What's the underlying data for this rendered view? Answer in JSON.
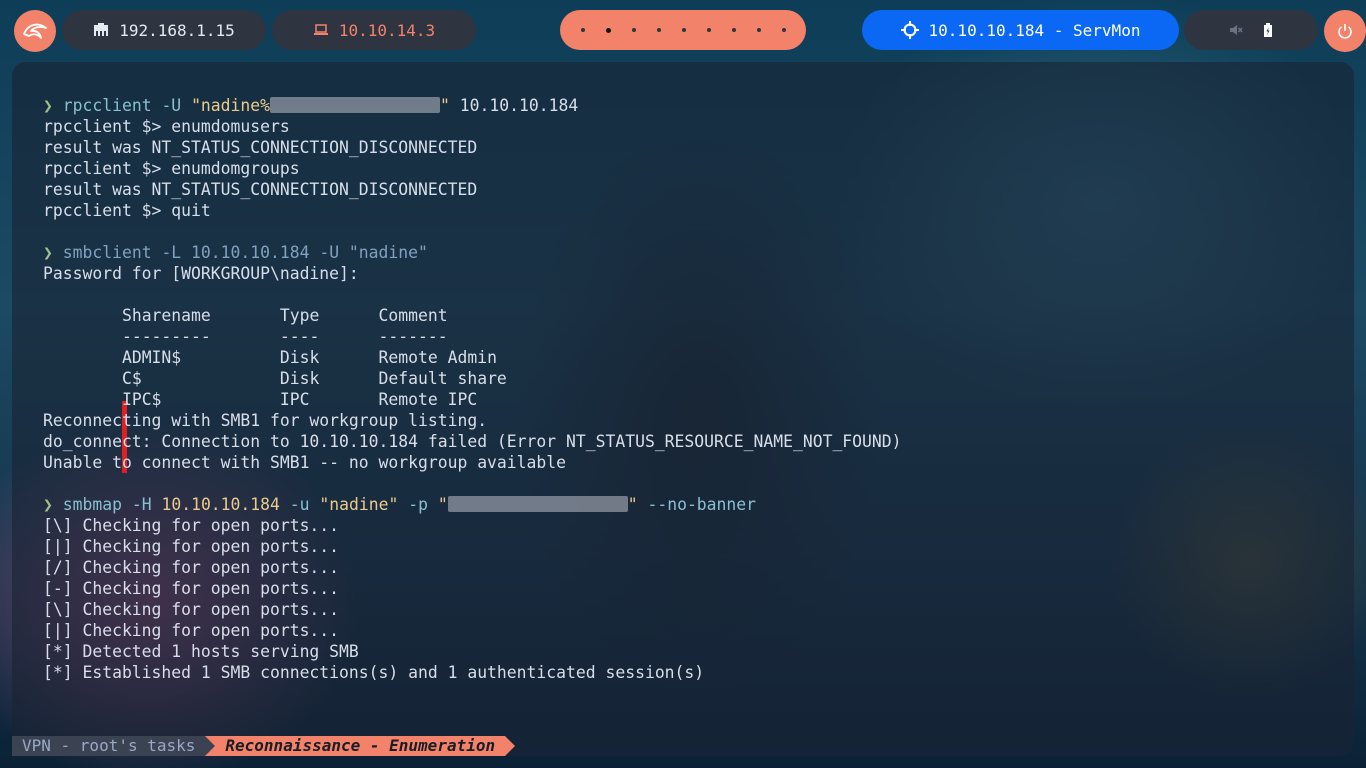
{
  "topbar": {
    "local_ip": "192.168.1.15",
    "vpn_ip": "10.10.14.3",
    "workspaces_count": 9,
    "active_workspace_index": 1,
    "target_label": "10.10.10.184 - ServMon",
    "icons": {
      "logo": "kali-dragon-icon",
      "local": "ethernet-icon",
      "vpn": "laptop-icon",
      "target": "crosshair-icon",
      "mute": "volume-muted-icon",
      "battery": "battery-icon",
      "power": "power-icon"
    },
    "colors": {
      "accent": "#f2836a",
      "target": "#0a68f5",
      "pill": "#2e3440"
    }
  },
  "terminal": {
    "block1": {
      "prompt": "❯",
      "cmd": "rpcclient",
      "flag": "-U",
      "arg_prefix": "\"nadine%",
      "arg_suffix": "\"",
      "host": "10.10.10.184",
      "out": [
        "rpcclient $> enumdomusers",
        "result was NT_STATUS_CONNECTION_DISCONNECTED",
        "rpcclient $> enumdomgroups",
        "result was NT_STATUS_CONNECTION_DISCONNECTED",
        "rpcclient $> quit"
      ]
    },
    "block2": {
      "prompt": "❯",
      "cmd": "smbclient",
      "rest": "-L 10.10.10.184 -U \"nadine\"",
      "password_line": "Password for [WORKGROUP\\nadine]:",
      "share_header": "\tSharename       Type      Comment",
      "share_rule": "\t---------       ----      -------",
      "shares": [
        "\tADMIN$          Disk      Remote Admin",
        "\tC$              Disk      Default share",
        "\tIPC$            IPC       Remote IPC"
      ],
      "out": [
        "Reconnecting with SMB1 for workgroup listing.",
        "do_connect: Connection to 10.10.10.184 failed (Error NT_STATUS_RESOURCE_NAME_NOT_FOUND)",
        "Unable to connect with SMB1 -- no workgroup available"
      ]
    },
    "block3": {
      "prompt": "❯",
      "cmd": "smbmap",
      "flag_h": "-H",
      "host": "10.10.10.184",
      "flag_u": "-u",
      "user": "\"nadine\"",
      "flag_p": "-p",
      "pass_prefix": "\"",
      "pass_suffix": "\"",
      "flag_nb": "--no-banner",
      "out": [
        "[\\] Checking for open ports...",
        "[|] Checking for open ports...",
        "[/] Checking for open ports...",
        "[-] Checking for open ports...",
        "[\\] Checking for open ports...",
        "[|] Checking for open ports...",
        "[*] Detected 1 hosts serving SMB",
        "[*] Established 1 SMB connections(s) and 1 authenticated session(s)"
      ]
    }
  },
  "tmux": {
    "session": "VPN - root's tasks",
    "window": "Reconnaissance - Enumeration"
  }
}
